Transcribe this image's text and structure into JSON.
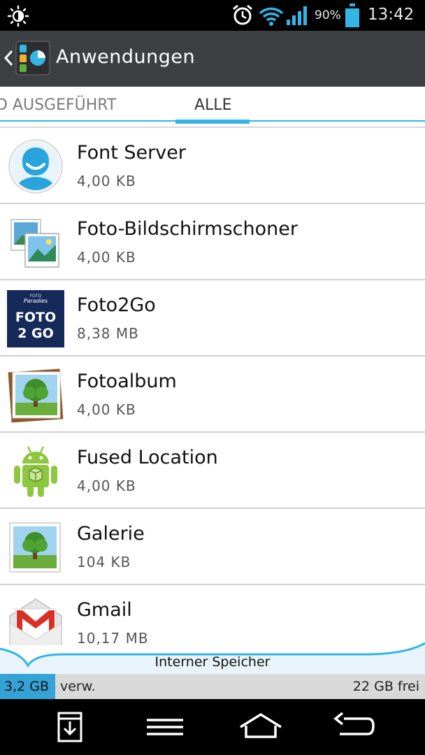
{
  "status_bar": {
    "battery_percent": "90%",
    "battery_level": 0.9,
    "time": "13:42",
    "icons": [
      "brightness-icon",
      "alarm-icon",
      "wifi-icon",
      "signal-icon",
      "battery-icon"
    ]
  },
  "action_bar": {
    "title": "Anwendungen",
    "back_icon": "chevron-left-icon",
    "app_icon": "apps-icon"
  },
  "tabs": [
    {
      "label": "D AUSGEFÜHRT",
      "active": false
    },
    {
      "label": "ALLE",
      "active": true
    }
  ],
  "apps": [
    {
      "name": "Font Server",
      "size": "4,00 KB",
      "icon": "person-avatar-icon"
    },
    {
      "name": "Foto-Bildschirmschoner",
      "size": "4,00 KB",
      "icon": "photo-screensaver-icon"
    },
    {
      "name": "Foto2Go",
      "size": "8,38 MB",
      "icon": "foto2go-icon",
      "icon_text": [
        "FOTO",
        "Paradies",
        "FOTO",
        "2 GO"
      ]
    },
    {
      "name": "Fotoalbum",
      "size": "4,00 KB",
      "icon": "photo-album-icon"
    },
    {
      "name": "Fused Location",
      "size": "4,00 KB",
      "icon": "android-icon"
    },
    {
      "name": "Galerie",
      "size": "104 KB",
      "icon": "gallery-icon"
    },
    {
      "name": "Gmail",
      "size": "10,17 MB",
      "icon": "gmail-icon"
    }
  ],
  "storage": {
    "label": "Interner Speicher",
    "used": "3,2 GB",
    "used_suffix": "verw.",
    "free": "22 GB frei",
    "used_fraction": 0.13,
    "accent": "#33a3d6"
  },
  "nav_bar": {
    "buttons": [
      "download-icon",
      "menu-icon",
      "home-icon",
      "back-icon"
    ]
  },
  "colors": {
    "accent": "#33b5e5",
    "action_bar": "#3d4042",
    "status_bar": "#000000"
  }
}
